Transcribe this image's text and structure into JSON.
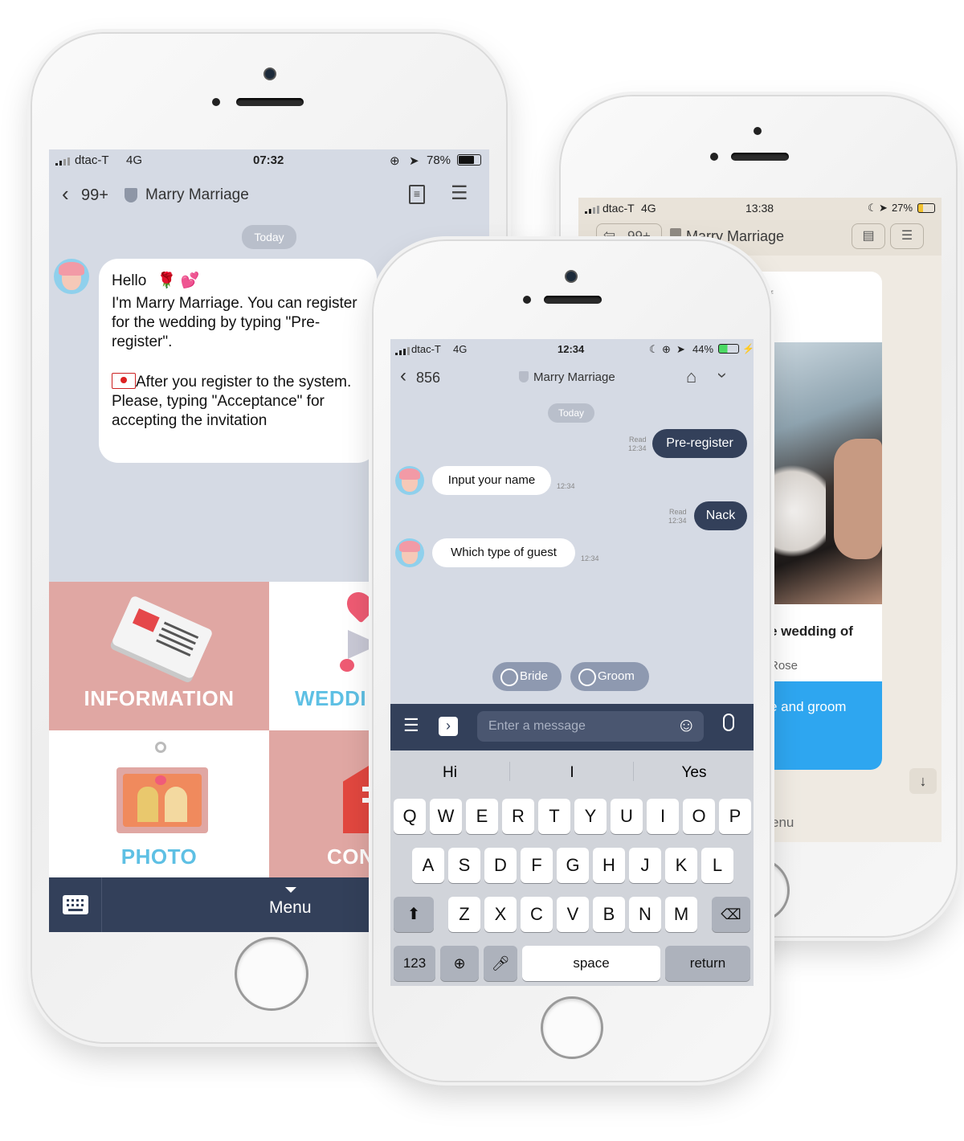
{
  "left_phone": {
    "status": {
      "carrier": "dtac-T",
      "network": "4G",
      "time": "07:32",
      "battery": "78%"
    },
    "nav": {
      "back_count": "99+",
      "title": "Marry Marriage"
    },
    "day_chip": "Today",
    "message": {
      "line1": "Hello",
      "line2": "I'm Marry Marriage. You can register for the wedding by typing \"Pre-register\".",
      "line3": "After you register to the system. Please, typing \"Acceptance\" for accepting the invitation"
    },
    "tiles": [
      "INFORMATION",
      "WEDDI",
      "PHOTO",
      "CON"
    ],
    "menu_label": "Menu"
  },
  "middle_phone": {
    "status": {
      "carrier": "dtac-T",
      "network": "4G",
      "time": "12:34",
      "battery": "44%"
    },
    "nav": {
      "back_count": "856",
      "title": "Marry Marriage"
    },
    "day_chip": "Today",
    "messages": [
      {
        "side": "right",
        "text": "Pre-register",
        "read": "Read",
        "time": "12:34"
      },
      {
        "side": "left",
        "text": "Input your name",
        "time": "12:34"
      },
      {
        "side": "right",
        "text": "Nack",
        "read": "Read",
        "time": "12:34"
      },
      {
        "side": "left",
        "text": "Which type of guest",
        "time": "12:34"
      }
    ],
    "quick_replies": [
      "Bride",
      "Groom"
    ],
    "input_placeholder": "Enter a message",
    "suggestions": [
      "Hi",
      "I",
      "Yes"
    ],
    "keyboard": {
      "row1": [
        "Q",
        "W",
        "E",
        "R",
        "T",
        "Y",
        "U",
        "I",
        "O",
        "P"
      ],
      "row2": [
        "A",
        "S",
        "D",
        "F",
        "G",
        "H",
        "J",
        "K",
        "L"
      ],
      "row3": [
        "Z",
        "X",
        "C",
        "V",
        "B",
        "N",
        "M"
      ],
      "numbers_key": "123",
      "space_key": "space",
      "return_key": "return"
    }
  },
  "right_phone": {
    "status": {
      "carrier": "dtac-T",
      "network": "4G",
      "time": "13:38",
      "battery": "27%"
    },
    "nav": {
      "back_count": "99+",
      "title": "Marry Marriage"
    },
    "card_fragment_top": "f",
    "card_title": "e wedding of",
    "card_subtitle": "Rose",
    "card_button": "e and groom",
    "menu_fragment": "enu"
  },
  "colors": {
    "chat_bg": "#d5dae4",
    "navy": "#33405a",
    "pink_tile": "#e0a7a3",
    "blue_text": "#5ec0e4",
    "card_blue": "#2ea6f0",
    "beige": "#efeae2"
  }
}
